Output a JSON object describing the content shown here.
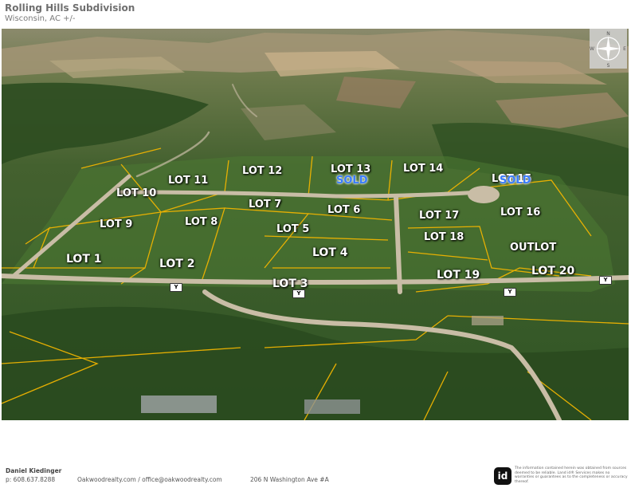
{
  "header": {
    "title": "Rolling Hills Subdivision",
    "subtitle": "Wisconsin,  AC +/-"
  },
  "map": {
    "lots": [
      {
        "id": "lot-10",
        "label": "LOT 10"
      },
      {
        "id": "lot-11",
        "label": "LOT 11"
      },
      {
        "id": "lot-12",
        "label": "LOT 12"
      },
      {
        "id": "lot-13",
        "label": "LOT 13"
      },
      {
        "id": "lot-14",
        "label": "LOT 14"
      },
      {
        "id": "lot-15",
        "label": "LOT 15"
      },
      {
        "id": "lot-7",
        "label": "LOT 7"
      },
      {
        "id": "lot-6",
        "label": "LOT 6"
      },
      {
        "id": "lot-16",
        "label": "LOT 16"
      },
      {
        "id": "lot-17",
        "label": "LOT 17"
      },
      {
        "id": "lot-9",
        "label": "LOT 9"
      },
      {
        "id": "lot-8",
        "label": "LOT 8"
      },
      {
        "id": "lot-5",
        "label": "LOT 5"
      },
      {
        "id": "lot-18",
        "label": "LOT 18"
      },
      {
        "id": "outlot",
        "label": "OUTLOT"
      },
      {
        "id": "lot-4",
        "label": "LOT 4"
      },
      {
        "id": "lot-1",
        "label": "LOT 1"
      },
      {
        "id": "lot-2",
        "label": "LOT 2"
      },
      {
        "id": "lot-20",
        "label": "LOT 20"
      },
      {
        "id": "lot-19",
        "label": "LOT 19"
      },
      {
        "id": "lot-3",
        "label": "LOT 3"
      }
    ],
    "sold_label": "SOLD",
    "road_sign": "Y",
    "compass": [
      "N",
      "E",
      "S",
      "W"
    ],
    "colors": {
      "lot_line": "#f0b400",
      "sold": "#3a7dff",
      "road": "#c9bda6"
    }
  },
  "footer": {
    "agent_name": "Daniel Kiedinger",
    "agent_phone": "p: 608.637.8288",
    "website": "Oakwoodrealty.com  /  office@oakwoodrealty.com",
    "address": "206 N Washington Ave #A",
    "logo_text": "id",
    "disclaimer": "The information contained herein was obtained from sources deemed to be reliable. Land id® Services makes no warranties or guarantees as to the completeness or accuracy thereof."
  }
}
